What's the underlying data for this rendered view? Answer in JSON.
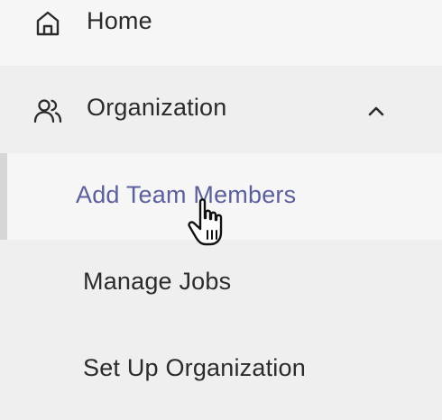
{
  "nav": {
    "home": {
      "label": "Home",
      "icon": "home-icon"
    },
    "organization": {
      "label": "Organization",
      "icon": "users-icon",
      "expanded": true,
      "toggle_icon": "chevron-up-icon",
      "children": [
        {
          "label": "Add Team Members",
          "active": true
        },
        {
          "label": "Manage Jobs",
          "active": false
        },
        {
          "label": "Set Up Organization",
          "active": false
        }
      ]
    }
  },
  "colors": {
    "active_text": "#5b5f9c",
    "text": "#2b2b2b",
    "background": "#efefef",
    "highlight": "#f6f6f6",
    "active_indicator": "#d6d6d6"
  },
  "cursor": {
    "icon": "hand-pointer-icon"
  }
}
